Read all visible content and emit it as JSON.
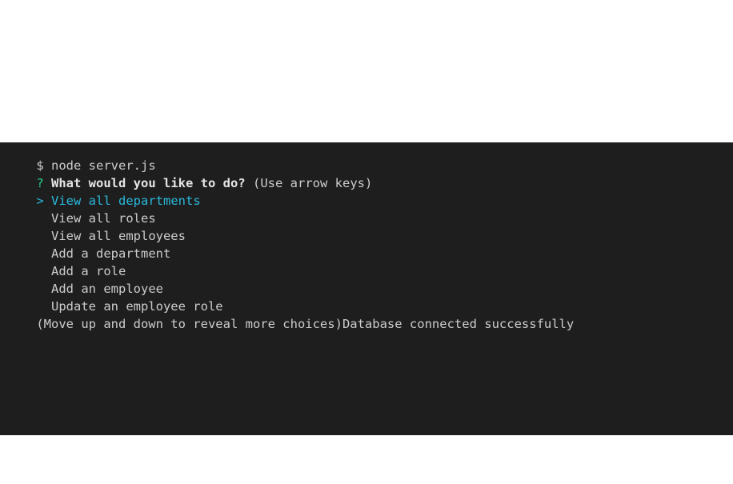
{
  "terminal": {
    "command_line": {
      "prompt": "$",
      "command": "node server.js"
    },
    "question": {
      "marker": "?",
      "text": "What would you like to do?",
      "hint": "(Use arrow keys)"
    },
    "pointer": ">",
    "choices": [
      {
        "label": "View all departments",
        "selected": true
      },
      {
        "label": "View all roles",
        "selected": false
      },
      {
        "label": "View all employees",
        "selected": false
      },
      {
        "label": "Add a department",
        "selected": false
      },
      {
        "label": "Add a role",
        "selected": false
      },
      {
        "label": "Add an employee",
        "selected": false
      },
      {
        "label": "Update an employee role",
        "selected": false
      }
    ],
    "footer_hint": "(Move up and down to reveal more choices)",
    "status_message": "Database connected successfully"
  },
  "colors": {
    "background": "#1e1e1e",
    "text": "#cccccc",
    "question_mark": "#23d18b",
    "selected": "#29b8db"
  }
}
